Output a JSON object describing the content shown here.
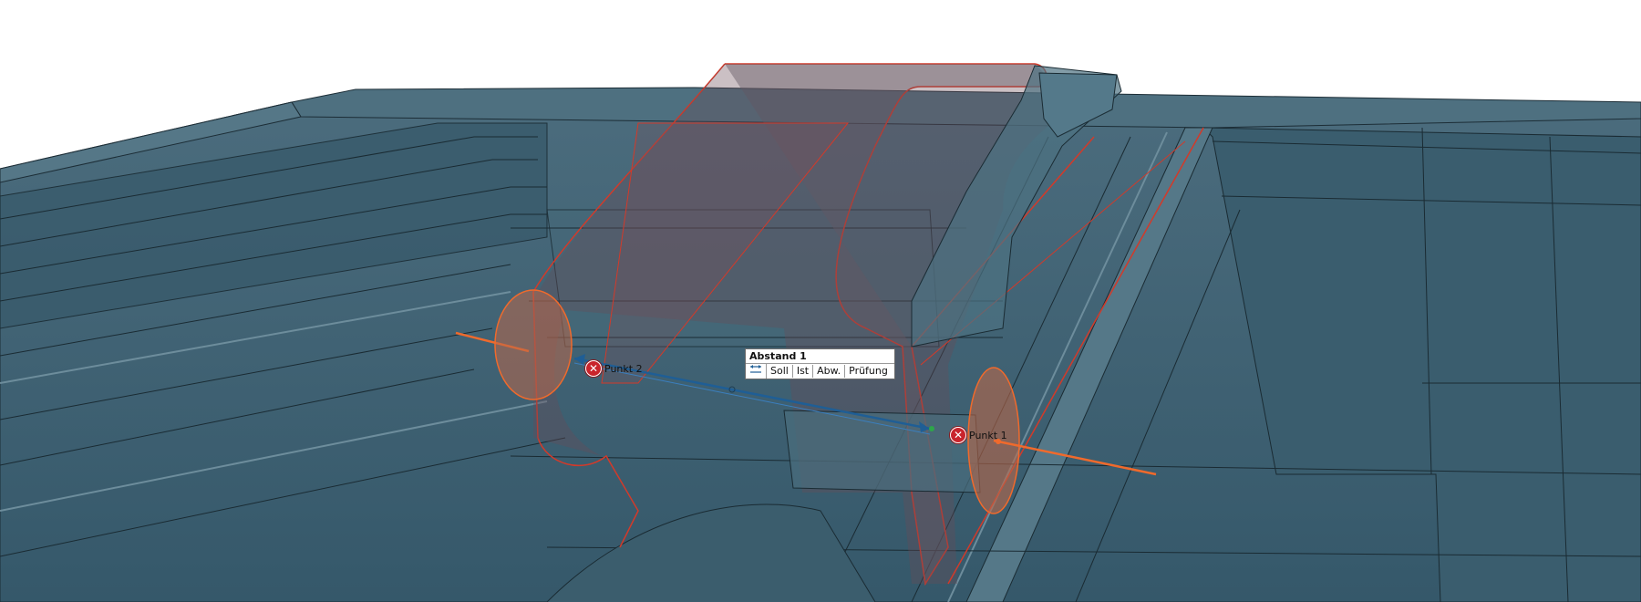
{
  "measurement": {
    "title": "Abstand 1",
    "columns": [
      "Soll",
      "Ist",
      "Abw.",
      "Prüfung"
    ],
    "icon": "distance-arrows-icon"
  },
  "points": {
    "p1": {
      "label": "Punkt 1",
      "icon": "error-x-icon"
    },
    "p2": {
      "label": "Punkt 2",
      "icon": "error-x-icon"
    }
  },
  "colors": {
    "model_body": "#3d5f70",
    "model_dark": "#2b4656",
    "model_light": "#5c7f90",
    "selection_edge": "#d23a2a",
    "axis_orange": "#f06a2c",
    "error_red": "#c9242c",
    "distance_blue": "#1f5e95"
  }
}
